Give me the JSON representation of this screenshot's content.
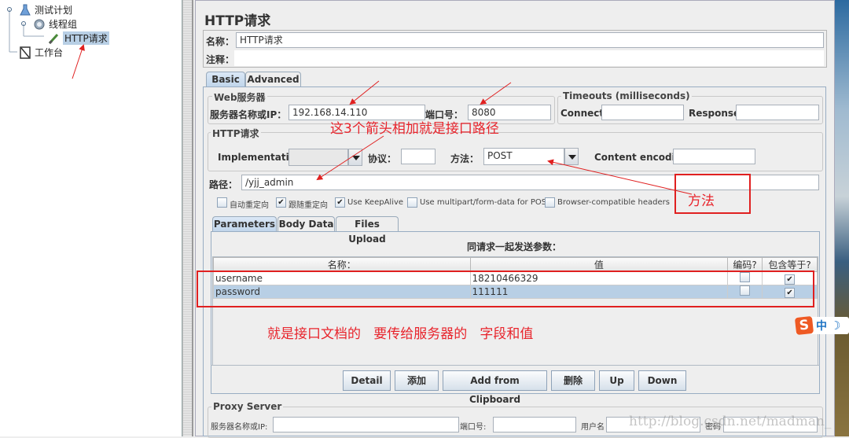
{
  "tree": {
    "items": [
      {
        "label": "测试计划",
        "icon": "test-plan-icon"
      },
      {
        "label": "线程组",
        "icon": "gear-icon"
      },
      {
        "label": "HTTP请求",
        "icon": "sampler-pipette-icon",
        "selected": true
      },
      {
        "label": "工作台",
        "icon": "workbench-icon"
      }
    ]
  },
  "panel": {
    "title": "HTTP请求",
    "name_label": "名称：",
    "name_value": "HTTP请求",
    "comment_label": "注释：",
    "comment_value": "",
    "tabs": [
      {
        "label": "Basic",
        "active": true
      },
      {
        "label": "Advanced",
        "active": false
      }
    ]
  },
  "web_server": {
    "title": "Web服务器",
    "host_label": "服务器名称或IP：",
    "host_value": "192.168.14.110",
    "port_label": "端口号：",
    "port_value": "8080"
  },
  "timeouts": {
    "title": "Timeouts (milliseconds)",
    "connect_label": "Connect:",
    "connect_value": "",
    "response_label": "Response:",
    "response_value": ""
  },
  "http_request": {
    "title": "HTTP请求",
    "implementation_label": "Implementation:",
    "implementation_value": "",
    "protocol_label": "协议：",
    "protocol_value": "",
    "method_label": "方法：",
    "method_value": "POST",
    "encoding_label": "Content encoding:",
    "encoding_value": "",
    "path_label": "路径：",
    "path_value": "/yjj_admin",
    "checkboxes": [
      {
        "label": "自动重定向",
        "checked": false
      },
      {
        "label": "跟随重定向",
        "checked": true
      },
      {
        "label": "Use KeepAlive",
        "checked": true
      },
      {
        "label": "Use multipart/form-data for POST",
        "checked": false
      },
      {
        "label": "Browser-compatible headers",
        "checked": false
      }
    ]
  },
  "sub_tabs": [
    {
      "label": "Parameters",
      "active": true
    },
    {
      "label": "Body Data",
      "active": false
    },
    {
      "label": "Files Upload",
      "active": false
    }
  ],
  "params": {
    "caption": "同请求一起发送参数：",
    "columns": [
      "名称：",
      "值",
      "编码?",
      "包含等于?"
    ],
    "rows": [
      {
        "name": "username",
        "value": "18210466329",
        "encode": false,
        "include_equals": true,
        "selected": false
      },
      {
        "name": "password",
        "value": "111111",
        "encode": false,
        "include_equals": true,
        "selected": true
      }
    ],
    "check_mark": "✔"
  },
  "buttons": [
    "Detail",
    "添加",
    "Add from Clipboard",
    "删除",
    "Up",
    "Down"
  ],
  "proxy": {
    "title": "Proxy Server",
    "host_label": "服务器名称或IP:",
    "port_label": "端口号:",
    "user_label": "用户名",
    "password_label": "密码",
    "host_value": "",
    "port_value": "",
    "user_value": "",
    "password_value": ""
  },
  "annotations": {
    "arrows_note": "这3个箭头相加就是接口路径",
    "method_note": "方法",
    "params_note": "就是接口文档的   要传给服务器的   字段和值",
    "color": "#e8242c"
  },
  "ime": {
    "logo": "S",
    "mode": "中",
    "moon": "☽"
  },
  "watermark": "http://blog.csdn.net/madman_"
}
